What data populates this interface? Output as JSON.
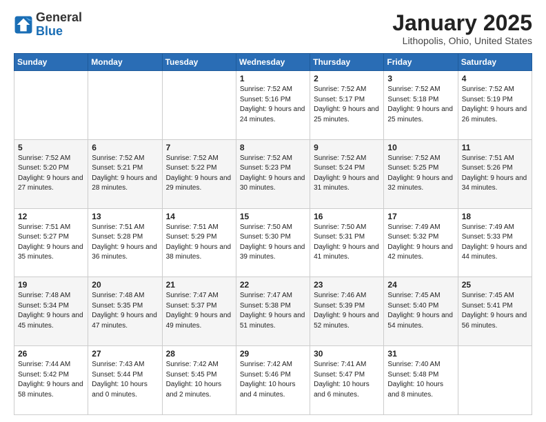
{
  "logo": {
    "general": "General",
    "blue": "Blue"
  },
  "header": {
    "month": "January 2025",
    "location": "Lithopolis, Ohio, United States"
  },
  "days_of_week": [
    "Sunday",
    "Monday",
    "Tuesday",
    "Wednesday",
    "Thursday",
    "Friday",
    "Saturday"
  ],
  "weeks": [
    [
      {
        "day": "",
        "info": ""
      },
      {
        "day": "",
        "info": ""
      },
      {
        "day": "",
        "info": ""
      },
      {
        "day": "1",
        "info": "Sunrise: 7:52 AM\nSunset: 5:16 PM\nDaylight: 9 hours\nand 24 minutes."
      },
      {
        "day": "2",
        "info": "Sunrise: 7:52 AM\nSunset: 5:17 PM\nDaylight: 9 hours\nand 25 minutes."
      },
      {
        "day": "3",
        "info": "Sunrise: 7:52 AM\nSunset: 5:18 PM\nDaylight: 9 hours\nand 25 minutes."
      },
      {
        "day": "4",
        "info": "Sunrise: 7:52 AM\nSunset: 5:19 PM\nDaylight: 9 hours\nand 26 minutes."
      }
    ],
    [
      {
        "day": "5",
        "info": "Sunrise: 7:52 AM\nSunset: 5:20 PM\nDaylight: 9 hours\nand 27 minutes."
      },
      {
        "day": "6",
        "info": "Sunrise: 7:52 AM\nSunset: 5:21 PM\nDaylight: 9 hours\nand 28 minutes."
      },
      {
        "day": "7",
        "info": "Sunrise: 7:52 AM\nSunset: 5:22 PM\nDaylight: 9 hours\nand 29 minutes."
      },
      {
        "day": "8",
        "info": "Sunrise: 7:52 AM\nSunset: 5:23 PM\nDaylight: 9 hours\nand 30 minutes."
      },
      {
        "day": "9",
        "info": "Sunrise: 7:52 AM\nSunset: 5:24 PM\nDaylight: 9 hours\nand 31 minutes."
      },
      {
        "day": "10",
        "info": "Sunrise: 7:52 AM\nSunset: 5:25 PM\nDaylight: 9 hours\nand 32 minutes."
      },
      {
        "day": "11",
        "info": "Sunrise: 7:51 AM\nSunset: 5:26 PM\nDaylight: 9 hours\nand 34 minutes."
      }
    ],
    [
      {
        "day": "12",
        "info": "Sunrise: 7:51 AM\nSunset: 5:27 PM\nDaylight: 9 hours\nand 35 minutes."
      },
      {
        "day": "13",
        "info": "Sunrise: 7:51 AM\nSunset: 5:28 PM\nDaylight: 9 hours\nand 36 minutes."
      },
      {
        "day": "14",
        "info": "Sunrise: 7:51 AM\nSunset: 5:29 PM\nDaylight: 9 hours\nand 38 minutes."
      },
      {
        "day": "15",
        "info": "Sunrise: 7:50 AM\nSunset: 5:30 PM\nDaylight: 9 hours\nand 39 minutes."
      },
      {
        "day": "16",
        "info": "Sunrise: 7:50 AM\nSunset: 5:31 PM\nDaylight: 9 hours\nand 41 minutes."
      },
      {
        "day": "17",
        "info": "Sunrise: 7:49 AM\nSunset: 5:32 PM\nDaylight: 9 hours\nand 42 minutes."
      },
      {
        "day": "18",
        "info": "Sunrise: 7:49 AM\nSunset: 5:33 PM\nDaylight: 9 hours\nand 44 minutes."
      }
    ],
    [
      {
        "day": "19",
        "info": "Sunrise: 7:48 AM\nSunset: 5:34 PM\nDaylight: 9 hours\nand 45 minutes."
      },
      {
        "day": "20",
        "info": "Sunrise: 7:48 AM\nSunset: 5:35 PM\nDaylight: 9 hours\nand 47 minutes."
      },
      {
        "day": "21",
        "info": "Sunrise: 7:47 AM\nSunset: 5:37 PM\nDaylight: 9 hours\nand 49 minutes."
      },
      {
        "day": "22",
        "info": "Sunrise: 7:47 AM\nSunset: 5:38 PM\nDaylight: 9 hours\nand 51 minutes."
      },
      {
        "day": "23",
        "info": "Sunrise: 7:46 AM\nSunset: 5:39 PM\nDaylight: 9 hours\nand 52 minutes."
      },
      {
        "day": "24",
        "info": "Sunrise: 7:45 AM\nSunset: 5:40 PM\nDaylight: 9 hours\nand 54 minutes."
      },
      {
        "day": "25",
        "info": "Sunrise: 7:45 AM\nSunset: 5:41 PM\nDaylight: 9 hours\nand 56 minutes."
      }
    ],
    [
      {
        "day": "26",
        "info": "Sunrise: 7:44 AM\nSunset: 5:42 PM\nDaylight: 9 hours\nand 58 minutes."
      },
      {
        "day": "27",
        "info": "Sunrise: 7:43 AM\nSunset: 5:44 PM\nDaylight: 10 hours\nand 0 minutes."
      },
      {
        "day": "28",
        "info": "Sunrise: 7:42 AM\nSunset: 5:45 PM\nDaylight: 10 hours\nand 2 minutes."
      },
      {
        "day": "29",
        "info": "Sunrise: 7:42 AM\nSunset: 5:46 PM\nDaylight: 10 hours\nand 4 minutes."
      },
      {
        "day": "30",
        "info": "Sunrise: 7:41 AM\nSunset: 5:47 PM\nDaylight: 10 hours\nand 6 minutes."
      },
      {
        "day": "31",
        "info": "Sunrise: 7:40 AM\nSunset: 5:48 PM\nDaylight: 10 hours\nand 8 minutes."
      },
      {
        "day": "",
        "info": ""
      }
    ]
  ]
}
